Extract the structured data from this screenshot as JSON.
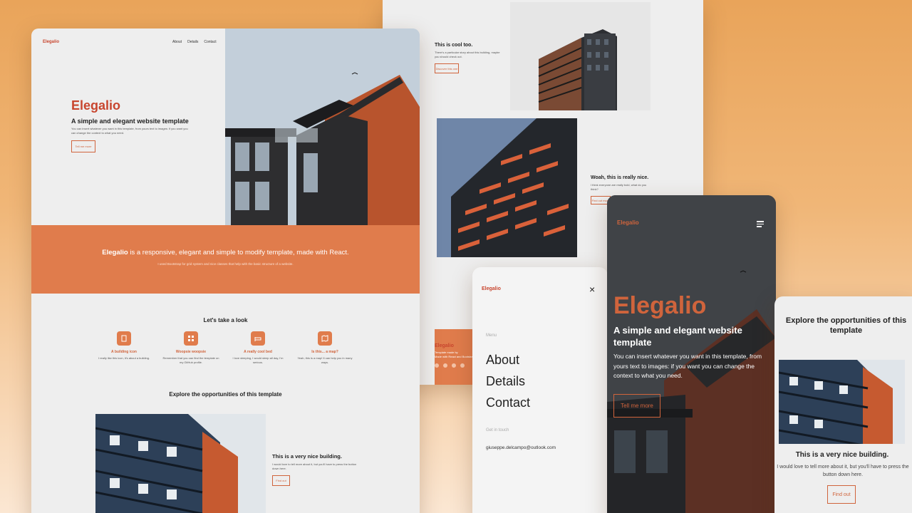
{
  "back_page": {
    "cool_title": "This is cool too.",
    "cool_text": "There's a particular story about this building, maybe you should check out.",
    "cool_button": "Discover this one",
    "wow_title": "Woah, this is really nice.",
    "wow_text": "I think everyone are really bold, what do you think?",
    "wow_button": "Find out more",
    "footer_brand": "Elegalio",
    "footer_text_1": "Template made by",
    "footer_text_2": "Made with React and Bootstrap"
  },
  "main_page": {
    "nav_brand": "Elegalio",
    "nav_links": [
      "About",
      "Details",
      "Contact"
    ],
    "hero_title": "Elegalio",
    "hero_subtitle": "A simple and elegant website template",
    "hero_text": "You can insert whatever you want in this template, from yours text to images: if you want you can change the context to what you need.",
    "hero_button": "Tell me more",
    "band_brand": "Elegalio",
    "band_rest": " is a responsive, elegant and simple to modify template, made with React.",
    "band_subtext": "I used Bootstrap for grid system and nice classes that help with the basic structure of a website.",
    "look_title": "Let's take a look",
    "features": [
      {
        "title": "A building icon",
        "text": "I really like this icon, it's about a building.",
        "icon": "building-icon"
      },
      {
        "title": "Woopsie woopsie",
        "text": "Remember that you can find the template on my GitHub profile.",
        "icon": "grid-icon"
      },
      {
        "title": "A really cool bed",
        "text": "I love sleeping, I would sleep all day, I'm serious.",
        "icon": "bed-icon"
      },
      {
        "title": "Is this... a map?",
        "text": "Yeah, this is a map! It can help you in many ways.",
        "icon": "map-icon"
      }
    ],
    "explore_title": "Explore the opportunities of this template",
    "nice_title": "This is a very nice building.",
    "nice_text": "I would love to tell more about it, but you'll have to press the button down here.",
    "nice_button": "Find out"
  },
  "menu_phone": {
    "brand": "Elegalio",
    "menu_label": "Menu",
    "items": [
      "About",
      "Details",
      "Contact"
    ],
    "contact_label": "Get in touch",
    "email": "giuseppe.delcampo@outlook.com"
  },
  "dark_phone": {
    "brand": "Elegalio",
    "title": "Elegalio",
    "subtitle": "A simple and elegant website template",
    "text": "You can insert whatever you want in this template, from yours text to images: if you want you can change the context to what you need.",
    "button": "Tell me more"
  },
  "right_phone": {
    "title": "Explore the opportunities of this template",
    "nice_title": "This is a very nice building.",
    "nice_text": "I would love to tell more about it, but you'll have to press the button down here.",
    "button": "Find out"
  },
  "colors": {
    "accent": "#e07c4c",
    "brand_red": "#c8452e",
    "background_orange": "#e9a45a"
  }
}
